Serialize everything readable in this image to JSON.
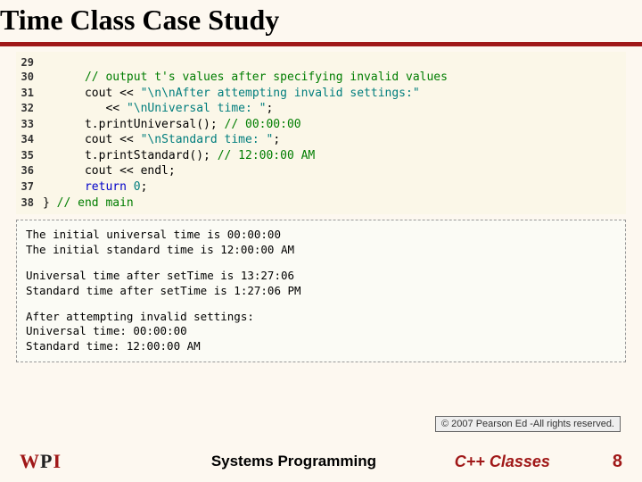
{
  "title": "Time Class Case Study",
  "code": {
    "lines": [
      {
        "n": "29",
        "ind": "",
        "tokens": []
      },
      {
        "n": "30",
        "ind": "      ",
        "tokens": [
          {
            "cls": "cm",
            "t": "// output t's values after specifying invalid values"
          }
        ]
      },
      {
        "n": "31",
        "ind": "      ",
        "tokens": [
          {
            "t": "cout << "
          },
          {
            "cls": "str",
            "t": "\"\\n\\nAfter attempting invalid settings:\""
          }
        ]
      },
      {
        "n": "32",
        "ind": "         ",
        "tokens": [
          {
            "t": "<< "
          },
          {
            "cls": "str",
            "t": "\"\\nUniversal time: \""
          },
          {
            "t": ";"
          }
        ]
      },
      {
        "n": "33",
        "ind": "      ",
        "tokens": [
          {
            "t": "t.printUniversal(); "
          },
          {
            "cls": "cm",
            "t": "// 00:00:00"
          }
        ]
      },
      {
        "n": "34",
        "ind": "      ",
        "tokens": [
          {
            "t": "cout << "
          },
          {
            "cls": "str",
            "t": "\"\\nStandard time: \""
          },
          {
            "t": ";"
          }
        ]
      },
      {
        "n": "35",
        "ind": "      ",
        "tokens": [
          {
            "t": "t.printStandard(); "
          },
          {
            "cls": "cm",
            "t": "// 12:00:00 AM"
          }
        ]
      },
      {
        "n": "36",
        "ind": "      ",
        "tokens": [
          {
            "t": "cout << endl;"
          }
        ]
      },
      {
        "n": "37",
        "ind": "      ",
        "tokens": [
          {
            "cls": "kw",
            "t": "return"
          },
          {
            "t": " "
          },
          {
            "cls": "str",
            "t": "0"
          },
          {
            "t": ";"
          }
        ]
      },
      {
        "n": "38",
        "ind": "",
        "tokens": [
          {
            "t": "} "
          },
          {
            "cls": "cm",
            "t": "// end main"
          }
        ]
      }
    ]
  },
  "output": {
    "line1": "The initial universal time is 00:00:00",
    "line2": "The initial standard time is 12:00:00 AM",
    "line3": "Universal time after setTime is 13:27:06",
    "line4": "Standard time after setTime is 1:27:06 PM",
    "line5": "After attempting invalid settings:",
    "line6": "Universal time: 00:00:00",
    "line7": "Standard time: 12:00:00 AM"
  },
  "copyright": "© 2007 Pearson Ed -All rights reserved.",
  "footer": {
    "logo_w": "W",
    "logo_p": "P",
    "logo_i": "I",
    "center": "Systems  Programming",
    "topic": "C++ Classes",
    "page": "8"
  }
}
